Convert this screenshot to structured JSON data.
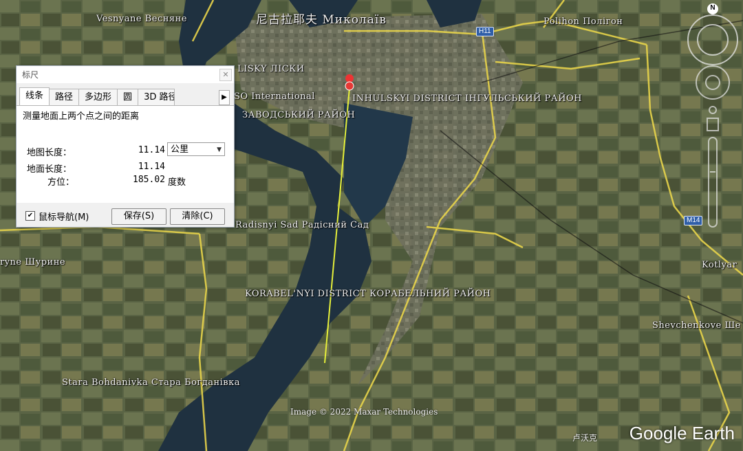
{
  "dialog": {
    "title": "标尺",
    "close_glyph": "✕",
    "tabs": [
      "线条",
      "路径",
      "多边形",
      "圆",
      "3D 路径"
    ],
    "tab_scroll_glyph": "▶",
    "description": "测量地面上两个点之间的距离",
    "map_length_label": "地图长度：",
    "map_length_value": "11.14",
    "unit": "公里",
    "unit_arrow": "▼",
    "ground_length_label": "地面长度：",
    "ground_length_value": "11.14",
    "heading_label": "方位：",
    "heading_value": "185.02",
    "heading_unit": "度数",
    "mouse_nav_checked": "✔",
    "mouse_nav_label": "鼠标导航(M)",
    "save_label": "保存(S)",
    "clear_label": "清除(C)"
  },
  "map": {
    "labels": {
      "mykolaiv": "尼古拉耶夫 Миколаїв",
      "vesnyane": "Vesnyane Весняне",
      "polihon": "Polihon Полігон",
      "lisky": "LISKY ЛІСКИ",
      "international": "SO International",
      "inhulskyi": "INHULSKYI DISTRICT ІНГУЛЬСЬКИЙ РАЙОН",
      "zavodskyi": "ЗАВОДСЬКИЙ РАЙОН",
      "radisnyi": "Radisnyi Sad Радісний Сад",
      "shuryne": "ryne Шурине",
      "korabelnyi": "KORABEL'NYI DISTRICT КОРАБЕЛЬНИЙ РАЙОН",
      "kotlyar": "Kotlyar",
      "shevchenkove": "Shevchenkove Ше",
      "stara": "Stara Bohdanivka Стара Богданівка"
    },
    "shields": {
      "h11": "H11",
      "m14": "M14"
    },
    "attribution": "Image © 2022 Maxar Technologies",
    "brand": "Google Earth",
    "brand_cn": "卢沃克",
    "compass_letter": "N"
  }
}
